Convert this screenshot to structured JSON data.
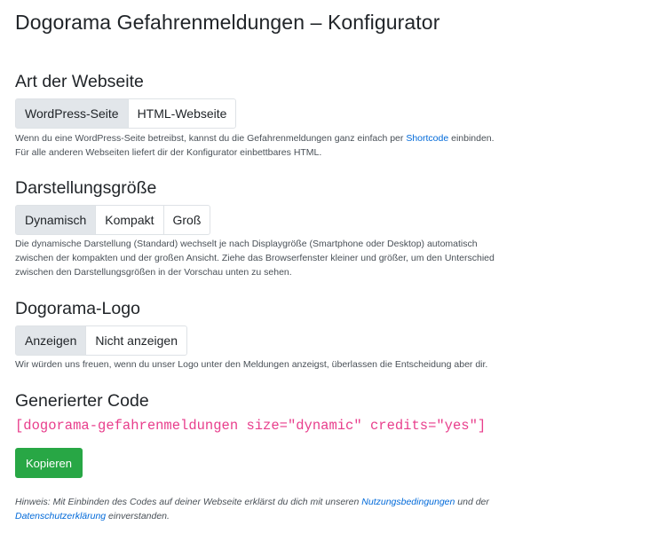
{
  "page": {
    "title": "Dogorama Gefahrenmeldungen – Konfigurator"
  },
  "website_type": {
    "heading": "Art der Webseite",
    "options": [
      "WordPress-Seite",
      "HTML-Webseite"
    ],
    "selected": "WordPress-Seite",
    "help_line1_before": "Wenn du eine WordPress-Seite betreibst, kannst du die Gefahrenmeldungen ganz einfach per ",
    "help_link": "Shortcode",
    "help_line1_after": " einbinden.",
    "help_line2": "Für alle anderen Webseiten liefert dir der Konfigurator einbettbares HTML."
  },
  "display_size": {
    "heading": "Darstellungsgröße",
    "options": [
      "Dynamisch",
      "Kompakt",
      "Groß"
    ],
    "selected": "Dynamisch",
    "help_line1": "Die dynamische Darstellung (Standard) wechselt je nach Displaygröße (Smartphone oder Desktop) automatisch",
    "help_line2": "zwischen der kompakten und der großen Ansicht. Ziehe das Browserfenster kleiner und größer, um den Unterschied",
    "help_line3": "zwischen den Darstellungsgrößen in der Vorschau unten zu sehen."
  },
  "logo": {
    "heading": "Dogorama-Logo",
    "options": [
      "Anzeigen",
      "Nicht anzeigen"
    ],
    "selected": "Anzeigen",
    "help": "Wir würden uns freuen, wenn du unser Logo unter den Meldungen anzeigst, überlassen die Entscheidung aber dir."
  },
  "generated_code": {
    "heading": "Generierter Code",
    "code": "[dogorama-gefahrenmeldungen size=\"dynamic\" credits=\"yes\"]",
    "copy_label": "Kopieren"
  },
  "note": {
    "before": "Hinweis: Mit Einbinden des Codes auf deiner Webseite erklärst du dich mit unseren ",
    "terms_link": "Nutzungsbedingungen",
    "middle": " und der",
    "privacy_link": "Datenschutzerklärung",
    "after": " einverstanden."
  },
  "colors": {
    "text": "#212529",
    "muted": "#495057",
    "link": "#0069d9",
    "code": "#e83e8c",
    "success": "#28a745",
    "active_toggle": "#e2e6ea",
    "border": "#dee2e6"
  }
}
